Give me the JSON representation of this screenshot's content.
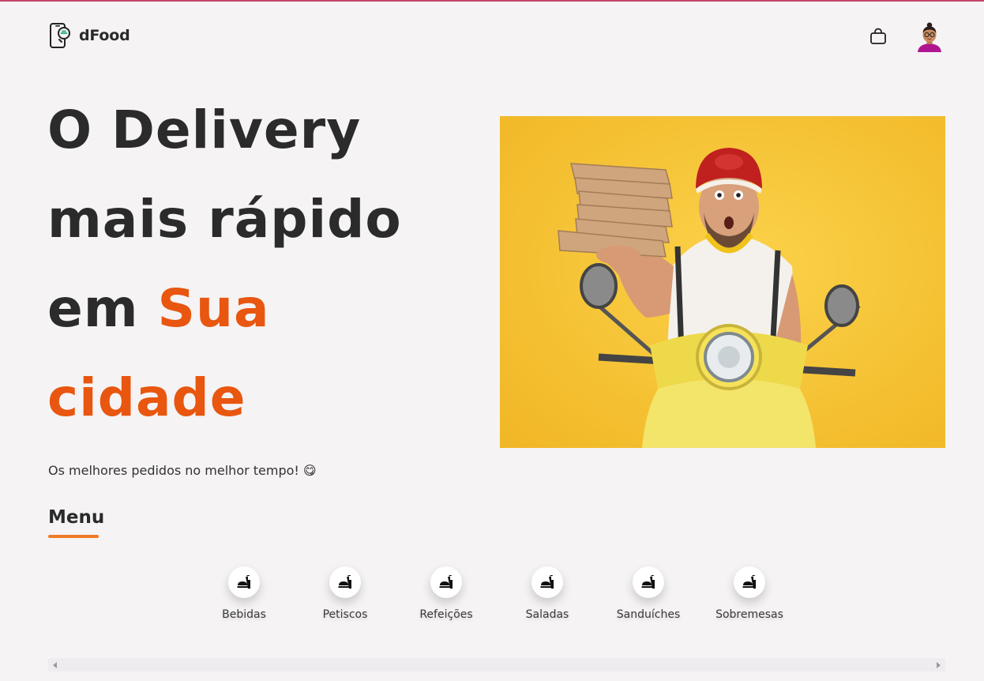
{
  "header": {
    "brand_name": "dFood",
    "brand_icon": "phone-chat-icon",
    "cart_icon": "shopping-bag-icon",
    "avatar_icon": "user-avatar"
  },
  "hero": {
    "title_line1": "O Delivery",
    "title_line2": "mais rápido",
    "title_line3_plain": "em ",
    "title_line3_accent": "Sua",
    "title_line4_accent": "cidade",
    "subtitle": "Os melhores pedidos no melhor tempo! 😋",
    "image_icon": "delivery-man-on-scooter-with-pizzas"
  },
  "menu": {
    "title": "Menu",
    "categories": [
      {
        "label": "Bebidas",
        "icon": "food-icon"
      },
      {
        "label": "Petiscos",
        "icon": "food-icon"
      },
      {
        "label": "Refeições",
        "icon": "food-icon"
      },
      {
        "label": "Saladas",
        "icon": "food-icon"
      },
      {
        "label": "Sanduíches",
        "icon": "food-icon"
      },
      {
        "label": "Sobremesas",
        "icon": "food-icon"
      }
    ]
  },
  "colors": {
    "accent": "#e8560f",
    "underline": "#ef7a25",
    "hero_bg": "#f6c531",
    "background": "#f5f3f4"
  }
}
